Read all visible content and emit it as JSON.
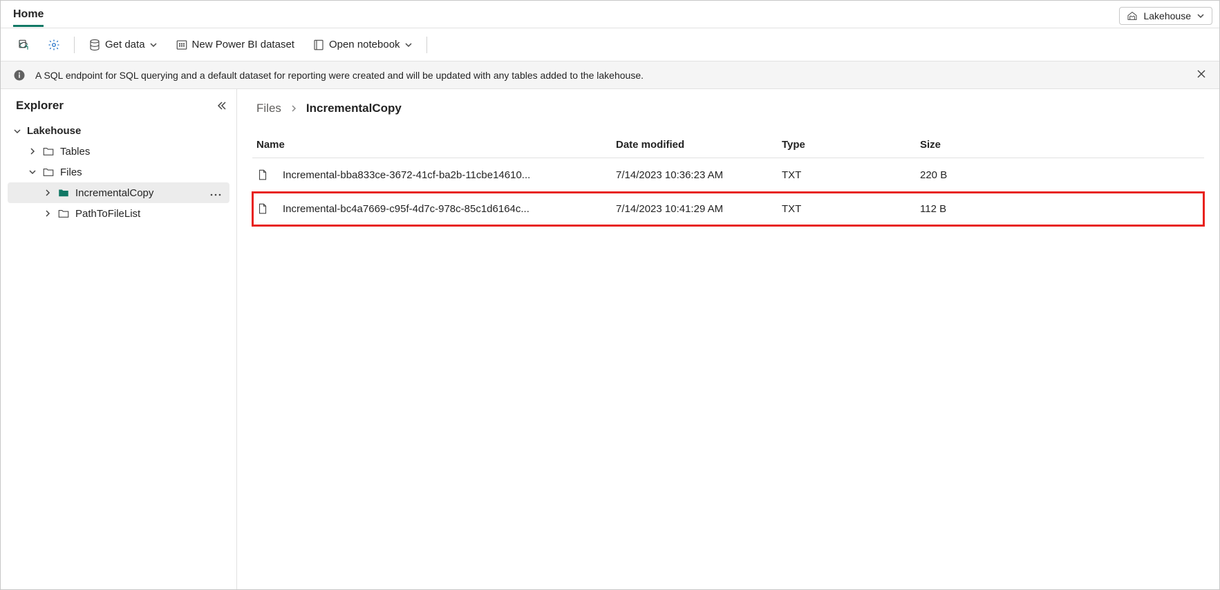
{
  "header": {
    "home_tab": "Home",
    "mode_label": "Lakehouse"
  },
  "toolbar": {
    "get_data": "Get data",
    "new_dataset": "New Power BI dataset",
    "open_notebook": "Open notebook"
  },
  "notification": {
    "text": "A SQL endpoint for SQL querying and a default dataset for reporting were created and will be updated with any tables added to the lakehouse."
  },
  "explorer": {
    "title": "Explorer",
    "root": "Lakehouse",
    "tables": "Tables",
    "files": "Files",
    "incremental_copy": "IncrementalCopy",
    "path_to_file_list": "PathToFileList"
  },
  "breadcrumb": {
    "files": "Files",
    "current": "IncrementalCopy"
  },
  "table": {
    "columns": {
      "name": "Name",
      "date_modified": "Date modified",
      "type": "Type",
      "size": "Size"
    },
    "rows": [
      {
        "name": "Incremental-bba833ce-3672-41cf-ba2b-11cbe14610...",
        "date": "7/14/2023 10:36:23 AM",
        "type": "TXT",
        "size": "220 B",
        "highlighted": false
      },
      {
        "name": "Incremental-bc4a7669-c95f-4d7c-978c-85c1d6164c...",
        "date": "7/14/2023 10:41:29 AM",
        "type": "TXT",
        "size": "112 B",
        "highlighted": true
      }
    ]
  }
}
